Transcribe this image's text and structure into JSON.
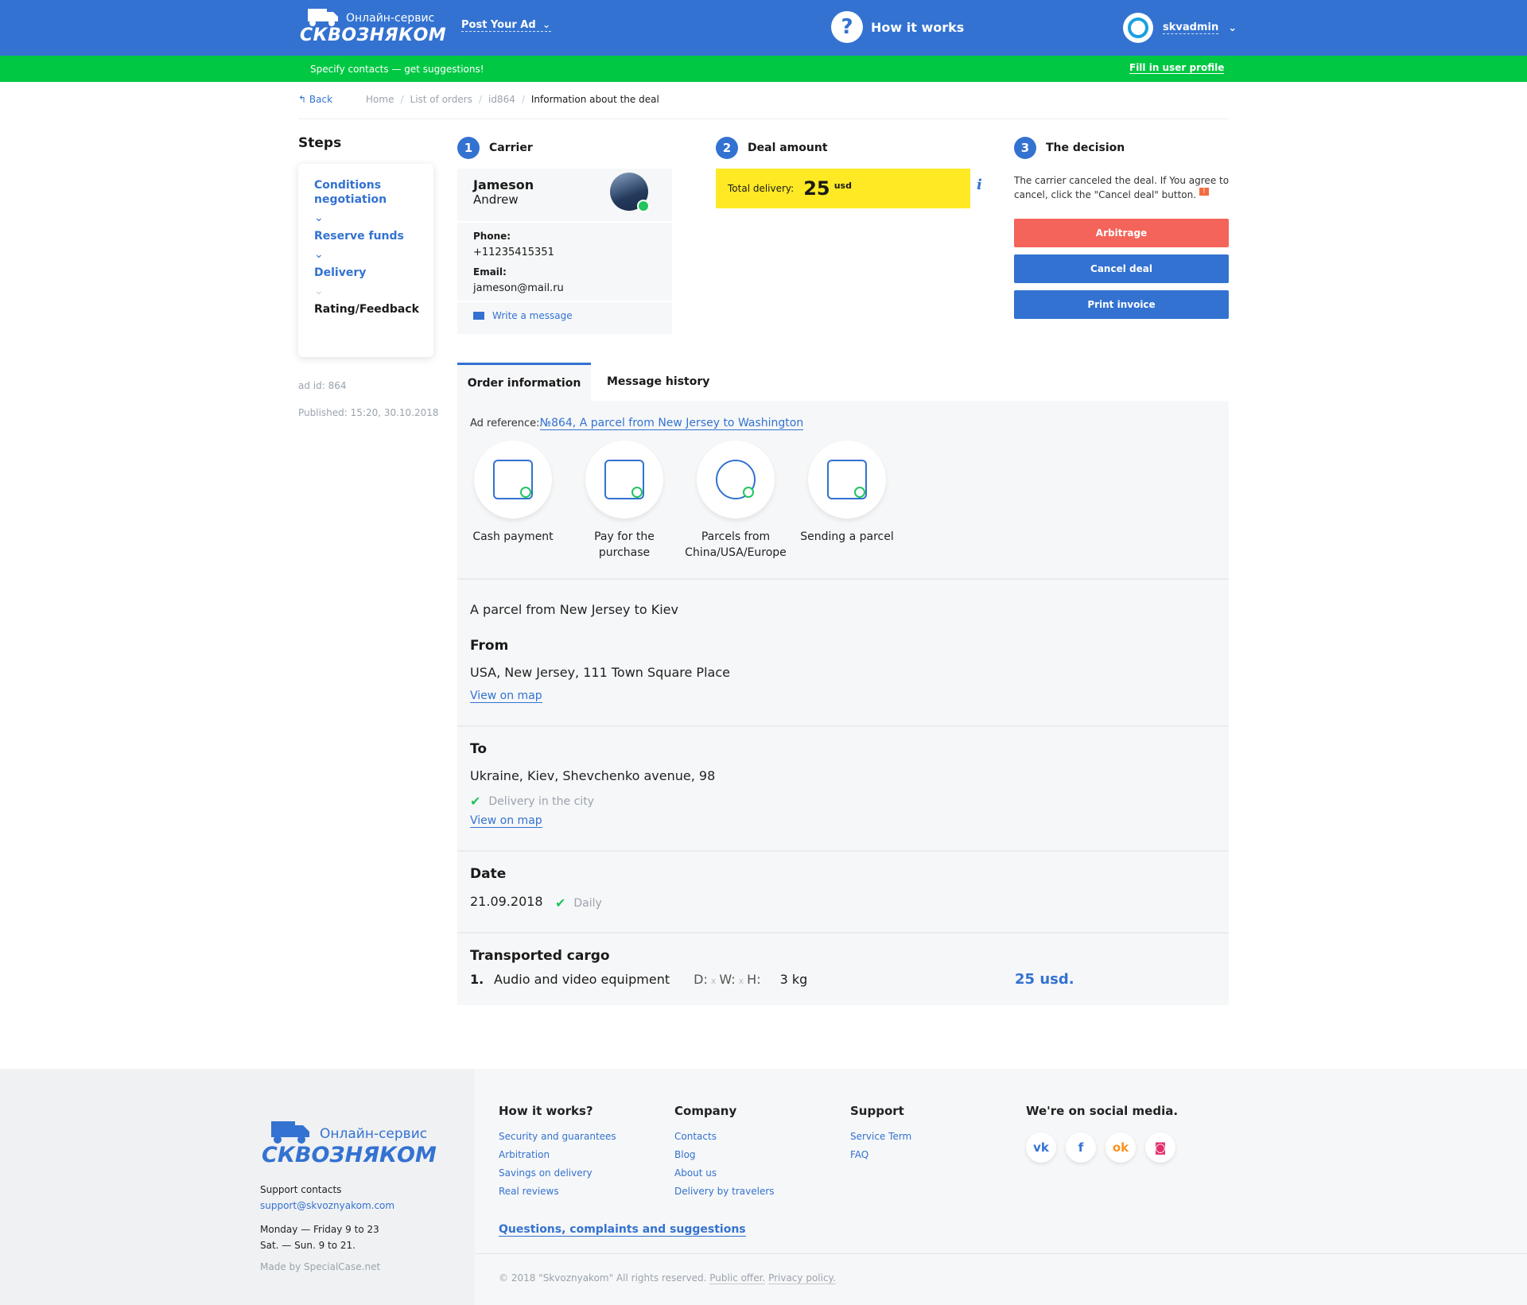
{
  "header": {
    "logo_top": "Онлайн-сервис",
    "logo_bottom": "СКВОЗНЯКОМ",
    "post_ad": "Post Your Ad",
    "how_it_works": "How it works",
    "username": "skvadmin"
  },
  "banner": {
    "text": "Specify contacts — get suggestions!",
    "link": "Fill in user profile"
  },
  "breadcrumb": {
    "back": "Back",
    "items": [
      "Home",
      "List of orders",
      "id864"
    ],
    "current": "Information about the deal"
  },
  "steps": {
    "title": "Steps",
    "items": [
      "Conditions negotiation",
      "Reserve funds",
      "Delivery",
      "Rating/Feedback"
    ],
    "ad_id": "ad id: 864",
    "published": "Published: 15:20, 30.10.2018"
  },
  "carrier": {
    "num": "1",
    "title": "Carrier",
    "first_name": "Jameson",
    "last_name": "Andrew",
    "phone_label": "Phone:",
    "phone": "+11235415351",
    "email_label": "Email:",
    "email": "jameson@mail.ru",
    "write_message": "Write a message"
  },
  "deal": {
    "num": "2",
    "title": "Deal amount",
    "label": "Total delivery:",
    "amount": "25",
    "currency": "usd",
    "info": "i"
  },
  "decision": {
    "num": "3",
    "title": "The decision",
    "text": "The carrier canceled the deal. If You agree to cancel, click the \"Cancel deal\" button.",
    "badge": "!",
    "arbitrage": "Arbitrage",
    "cancel": "Cancel deal",
    "print": "Print invoice"
  },
  "tabs": [
    "Order information",
    "Message history"
  ],
  "order": {
    "ad_ref_label": "Ad reference:",
    "ad_ref_link": "№864, A parcel from New Jersey to Washington",
    "icons": [
      {
        "label": "Cash payment",
        "icon": "cash-icon"
      },
      {
        "label": "Pay for the purchase",
        "icon": "wallet-icon"
      },
      {
        "label": "Parcels from China/USA/Europe",
        "icon": "globe-icon"
      },
      {
        "label": "Sending a parcel",
        "icon": "parcel-icon"
      }
    ],
    "description": "A parcel from New Jersey to Kiev",
    "from_title": "From",
    "from_address": "USA, New Jersey, 111 Town Square Place",
    "view_on_map": "View on map",
    "to_title": "To",
    "to_address": "Ukraine, Kiev, Shevchenko avenue, 98",
    "delivery_city": "Delivery in the city",
    "date_title": "Date",
    "date": "21.09.2018",
    "daily": "Daily",
    "cargo_title": "Transported cargo",
    "cargo": {
      "num": "1.",
      "name": "Audio and video equipment",
      "d": "D:",
      "x1": "x",
      "w": "W:",
      "x2": "x",
      "h": "H:",
      "weight": "3 kg",
      "price": "25 usd."
    }
  },
  "footer": {
    "support_label": "Support contacts",
    "support_email": "support@skvoznyakom.com",
    "hours1": "Monday — Friday 9 to 23",
    "hours2": "Sat. — Sun. 9 to 21.",
    "made_by": "Made by SpecialCase.net",
    "col1": {
      "title": "How it works?",
      "links": [
        "Security and guarantees",
        "Arbitration",
        "Savings on delivery",
        "Real reviews"
      ]
    },
    "col2": {
      "title": "Company",
      "links": [
        "Contacts",
        "Blog",
        "About us",
        "Delivery by travelers"
      ]
    },
    "col3": {
      "title": "Support",
      "links": [
        "Service Term",
        "FAQ"
      ]
    },
    "social_title": "We're on social media.",
    "social": [
      {
        "icon": "vk-icon",
        "glyph": "vk",
        "color": "#3372d1"
      },
      {
        "icon": "facebook-icon",
        "glyph": "f",
        "color": "#3372d1"
      },
      {
        "icon": "odnoklassniki-icon",
        "glyph": "ok",
        "color": "#f7931e"
      },
      {
        "icon": "instagram-icon",
        "glyph": "◙",
        "color": "#e1306c"
      }
    ],
    "questions": "Questions, complaints and suggestions",
    "copyright": "© 2018 \"Skvoznyakom\" All rights reserved.",
    "public_offer": "Public offer.",
    "privacy": "Privacy policy."
  }
}
